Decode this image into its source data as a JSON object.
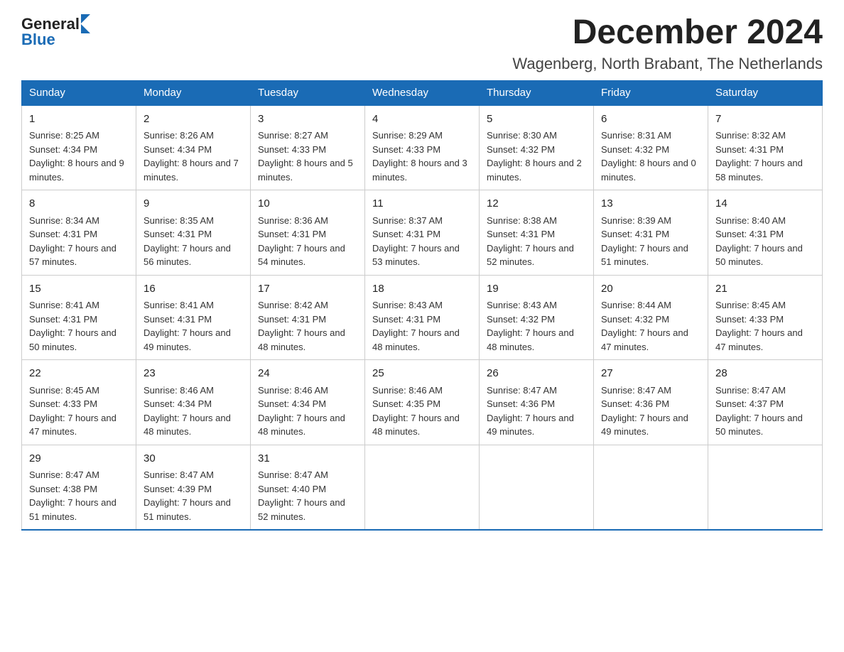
{
  "header": {
    "logo": {
      "text_general": "General",
      "text_blue": "Blue",
      "arrow": "▶"
    },
    "month_title": "December 2024",
    "location": "Wagenberg, North Brabant, The Netherlands"
  },
  "weekdays": [
    "Sunday",
    "Monday",
    "Tuesday",
    "Wednesday",
    "Thursday",
    "Friday",
    "Saturday"
  ],
  "weeks": [
    [
      {
        "day": "1",
        "sunrise": "8:25 AM",
        "sunset": "4:34 PM",
        "daylight": "8 hours and 9 minutes."
      },
      {
        "day": "2",
        "sunrise": "8:26 AM",
        "sunset": "4:34 PM",
        "daylight": "8 hours and 7 minutes."
      },
      {
        "day": "3",
        "sunrise": "8:27 AM",
        "sunset": "4:33 PM",
        "daylight": "8 hours and 5 minutes."
      },
      {
        "day": "4",
        "sunrise": "8:29 AM",
        "sunset": "4:33 PM",
        "daylight": "8 hours and 3 minutes."
      },
      {
        "day": "5",
        "sunrise": "8:30 AM",
        "sunset": "4:32 PM",
        "daylight": "8 hours and 2 minutes."
      },
      {
        "day": "6",
        "sunrise": "8:31 AM",
        "sunset": "4:32 PM",
        "daylight": "8 hours and 0 minutes."
      },
      {
        "day": "7",
        "sunrise": "8:32 AM",
        "sunset": "4:31 PM",
        "daylight": "7 hours and 58 minutes."
      }
    ],
    [
      {
        "day": "8",
        "sunrise": "8:34 AM",
        "sunset": "4:31 PM",
        "daylight": "7 hours and 57 minutes."
      },
      {
        "day": "9",
        "sunrise": "8:35 AM",
        "sunset": "4:31 PM",
        "daylight": "7 hours and 56 minutes."
      },
      {
        "day": "10",
        "sunrise": "8:36 AM",
        "sunset": "4:31 PM",
        "daylight": "7 hours and 54 minutes."
      },
      {
        "day": "11",
        "sunrise": "8:37 AM",
        "sunset": "4:31 PM",
        "daylight": "7 hours and 53 minutes."
      },
      {
        "day": "12",
        "sunrise": "8:38 AM",
        "sunset": "4:31 PM",
        "daylight": "7 hours and 52 minutes."
      },
      {
        "day": "13",
        "sunrise": "8:39 AM",
        "sunset": "4:31 PM",
        "daylight": "7 hours and 51 minutes."
      },
      {
        "day": "14",
        "sunrise": "8:40 AM",
        "sunset": "4:31 PM",
        "daylight": "7 hours and 50 minutes."
      }
    ],
    [
      {
        "day": "15",
        "sunrise": "8:41 AM",
        "sunset": "4:31 PM",
        "daylight": "7 hours and 50 minutes."
      },
      {
        "day": "16",
        "sunrise": "8:41 AM",
        "sunset": "4:31 PM",
        "daylight": "7 hours and 49 minutes."
      },
      {
        "day": "17",
        "sunrise": "8:42 AM",
        "sunset": "4:31 PM",
        "daylight": "7 hours and 48 minutes."
      },
      {
        "day": "18",
        "sunrise": "8:43 AM",
        "sunset": "4:31 PM",
        "daylight": "7 hours and 48 minutes."
      },
      {
        "day": "19",
        "sunrise": "8:43 AM",
        "sunset": "4:32 PM",
        "daylight": "7 hours and 48 minutes."
      },
      {
        "day": "20",
        "sunrise": "8:44 AM",
        "sunset": "4:32 PM",
        "daylight": "7 hours and 47 minutes."
      },
      {
        "day": "21",
        "sunrise": "8:45 AM",
        "sunset": "4:33 PM",
        "daylight": "7 hours and 47 minutes."
      }
    ],
    [
      {
        "day": "22",
        "sunrise": "8:45 AM",
        "sunset": "4:33 PM",
        "daylight": "7 hours and 47 minutes."
      },
      {
        "day": "23",
        "sunrise": "8:46 AM",
        "sunset": "4:34 PM",
        "daylight": "7 hours and 48 minutes."
      },
      {
        "day": "24",
        "sunrise": "8:46 AM",
        "sunset": "4:34 PM",
        "daylight": "7 hours and 48 minutes."
      },
      {
        "day": "25",
        "sunrise": "8:46 AM",
        "sunset": "4:35 PM",
        "daylight": "7 hours and 48 minutes."
      },
      {
        "day": "26",
        "sunrise": "8:47 AM",
        "sunset": "4:36 PM",
        "daylight": "7 hours and 49 minutes."
      },
      {
        "day": "27",
        "sunrise": "8:47 AM",
        "sunset": "4:36 PM",
        "daylight": "7 hours and 49 minutes."
      },
      {
        "day": "28",
        "sunrise": "8:47 AM",
        "sunset": "4:37 PM",
        "daylight": "7 hours and 50 minutes."
      }
    ],
    [
      {
        "day": "29",
        "sunrise": "8:47 AM",
        "sunset": "4:38 PM",
        "daylight": "7 hours and 51 minutes."
      },
      {
        "day": "30",
        "sunrise": "8:47 AM",
        "sunset": "4:39 PM",
        "daylight": "7 hours and 51 minutes."
      },
      {
        "day": "31",
        "sunrise": "8:47 AM",
        "sunset": "4:40 PM",
        "daylight": "7 hours and 52 minutes."
      },
      null,
      null,
      null,
      null
    ]
  ]
}
